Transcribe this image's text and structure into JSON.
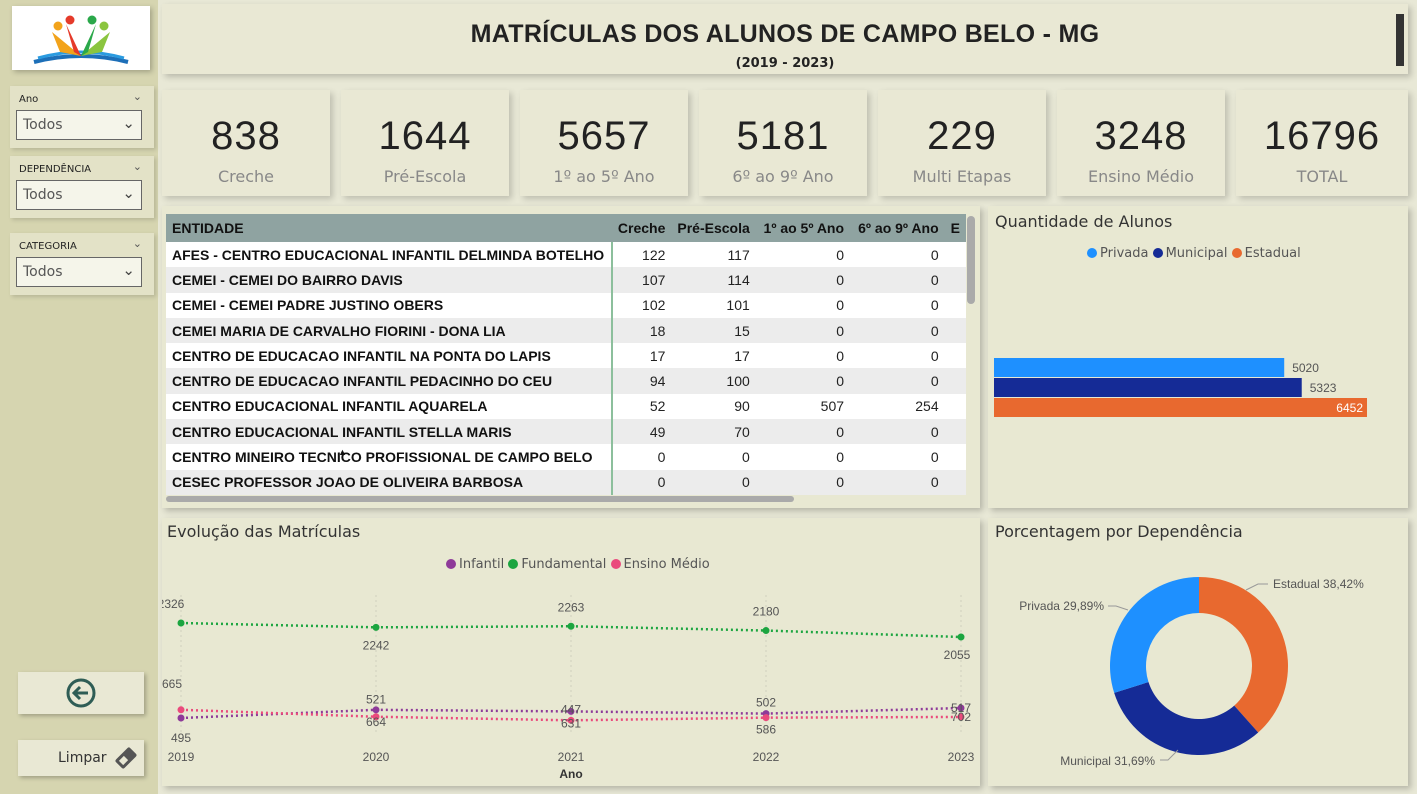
{
  "title": "MATRÍCULAS DOS ALUNOS DE CAMPO BELO - MG",
  "subtitle": "(2019 - 2023)",
  "filters": [
    {
      "label": "Ano",
      "value": "Todos"
    },
    {
      "label": "DEPENDÊNCIA",
      "value": "Todos"
    },
    {
      "label": "CATEGORIA",
      "value": "Todos"
    }
  ],
  "buttons": {
    "clear_label": "Limpar"
  },
  "kpis": [
    {
      "value": "838",
      "label": "Creche"
    },
    {
      "value": "1644",
      "label": "Pré-Escola"
    },
    {
      "value": "5657",
      "label": "1º ao 5º Ano"
    },
    {
      "value": "5181",
      "label": "6º ao 9º Ano"
    },
    {
      "value": "229",
      "label": "Multi Etapas"
    },
    {
      "value": "3248",
      "label": "Ensino Médio"
    },
    {
      "value": "16796",
      "label": "TOTAL"
    }
  ],
  "table": {
    "columns": [
      "ENTIDADE",
      "Creche",
      "Pré-Escola",
      "1º ao 5º Ano",
      "6º ao 9º Ano",
      "E"
    ],
    "rows": [
      [
        "AFES - CENTRO EDUCACIONAL INFANTIL DELMINDA BOTELHO",
        "122",
        "117",
        "0",
        "0",
        ""
      ],
      [
        "CEMEI - CEMEI DO BAIRRO DAVIS",
        "107",
        "114",
        "0",
        "0",
        ""
      ],
      [
        "CEMEI - CEMEI PADRE JUSTINO OBERS",
        "102",
        "101",
        "0",
        "0",
        ""
      ],
      [
        "CEMEI MARIA DE CARVALHO FIORINI - DONA LIA",
        "18",
        "15",
        "0",
        "0",
        ""
      ],
      [
        "CENTRO DE EDUCACAO INFANTIL NA PONTA DO LAPIS",
        "17",
        "17",
        "0",
        "0",
        ""
      ],
      [
        "CENTRO DE EDUCACAO INFANTIL PEDACINHO DO CEU",
        "94",
        "100",
        "0",
        "0",
        ""
      ],
      [
        "CENTRO EDUCACIONAL INFANTIL AQUARELA",
        "52",
        "90",
        "507",
        "254",
        ""
      ],
      [
        "CENTRO EDUCACIONAL INFANTIL STELLA MARIS",
        "49",
        "70",
        "0",
        "0",
        ""
      ],
      [
        "CENTRO MINEIRO TECNICO PROFISSIONAL DE CAMPO BELO",
        "0",
        "0",
        "0",
        "0",
        ""
      ],
      [
        "CESEC PROFESSOR JOAO DE OLIVEIRA BARBOSA",
        "0",
        "0",
        "0",
        "0",
        ""
      ]
    ]
  },
  "bar_chart": {
    "title": "Quantidade de Alunos"
  },
  "line_chart": {
    "title": "Evolução das Matrículas",
    "xlabel": "Ano"
  },
  "donut_chart": {
    "title": "Porcentagem por Dependência",
    "labels": [
      "Estadual 38,42%",
      "Privada 29,89%",
      "Municipal 31,69%"
    ]
  },
  "colors": {
    "privada": "#1e90ff",
    "municipal": "#152b96",
    "estadual": "#e8692f",
    "infantil": "#8e3a99",
    "fundamental": "#1ca540",
    "ensino_medio": "#ea4a7c"
  },
  "chart_data": [
    {
      "type": "bar",
      "title": "Quantidade de Alunos",
      "categories": [
        "Privada",
        "Municipal",
        "Estadual"
      ],
      "series": [
        {
          "name": "Quantidade de Alunos",
          "values": [
            5020,
            5323,
            6452
          ]
        }
      ],
      "legend": "top-center",
      "xlim": [
        0,
        7000
      ]
    },
    {
      "type": "line",
      "title": "Evolução das Matrículas",
      "xlabel": "Ano",
      "x": [
        "2019",
        "2020",
        "2021",
        "2022",
        "2023"
      ],
      "series": [
        {
          "name": "Infantil",
          "values": [
            495,
            664,
            631,
            586,
            702
          ]
        },
        {
          "name": "Fundamental",
          "values": [
            2326,
            2242,
            2263,
            2180,
            2055
          ]
        },
        {
          "name": "Ensino Médio",
          "values": [
            665,
            521,
            447,
            502,
            517
          ]
        }
      ],
      "legend": "top-center",
      "grid": true
    },
    {
      "type": "pie",
      "title": "Porcentagem por Dependência",
      "categories": [
        "Estadual",
        "Municipal",
        "Privada"
      ],
      "values": [
        38.42,
        31.69,
        29.89
      ],
      "hole": true
    }
  ]
}
